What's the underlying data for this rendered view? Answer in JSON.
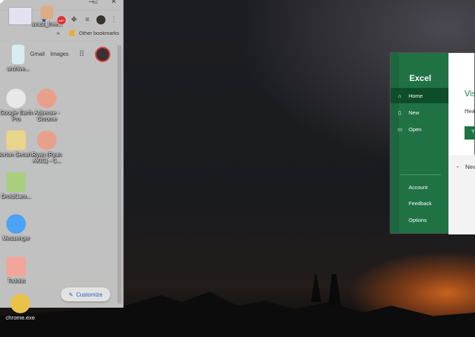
{
  "chrome": {
    "bookmarks_overflow": "»",
    "other_bookmarks": "Other bookmarks",
    "gmail": "Gmail",
    "images": "Images",
    "customize": "Customize",
    "toolbar_badge": "ABP",
    "window_controls": [
      "—",
      "☐",
      "✕"
    ]
  },
  "desktop": {
    "icons": [
      {
        "label": "archive...",
        "color": "#d9ecef"
      },
      {
        "label": "Google Earth Pro",
        "color": "#e8e8e8"
      },
      {
        "label": "Adsense - Chrome",
        "color": "#e9a08a"
      },
      {
        "label": "Norton Securi...",
        "color": "#e8d48a"
      },
      {
        "label": "Ryan (Ryan AKIC) - C...",
        "color": "#e9a08a"
      },
      {
        "label": "DroidCam...",
        "color": "#a9cf7e"
      },
      {
        "label": "Messenger",
        "color": "#4aa3f5"
      },
      {
        "label": "Todoist",
        "color": "#f2a59b"
      },
      {
        "label": "chrome.exe",
        "color": "#e9c24a"
      },
      {
        "label": "avast_free...",
        "color": "#f0a060"
      }
    ]
  },
  "excel": {
    "title": "Excel",
    "nav": [
      "Home",
      "New",
      "Open"
    ],
    "bottom_nav": [
      "Account",
      "Feedback",
      "Options"
    ],
    "heading": "Vis",
    "subheading": "Hea",
    "button": "T",
    "section": "New",
    "accent": "#207245"
  }
}
